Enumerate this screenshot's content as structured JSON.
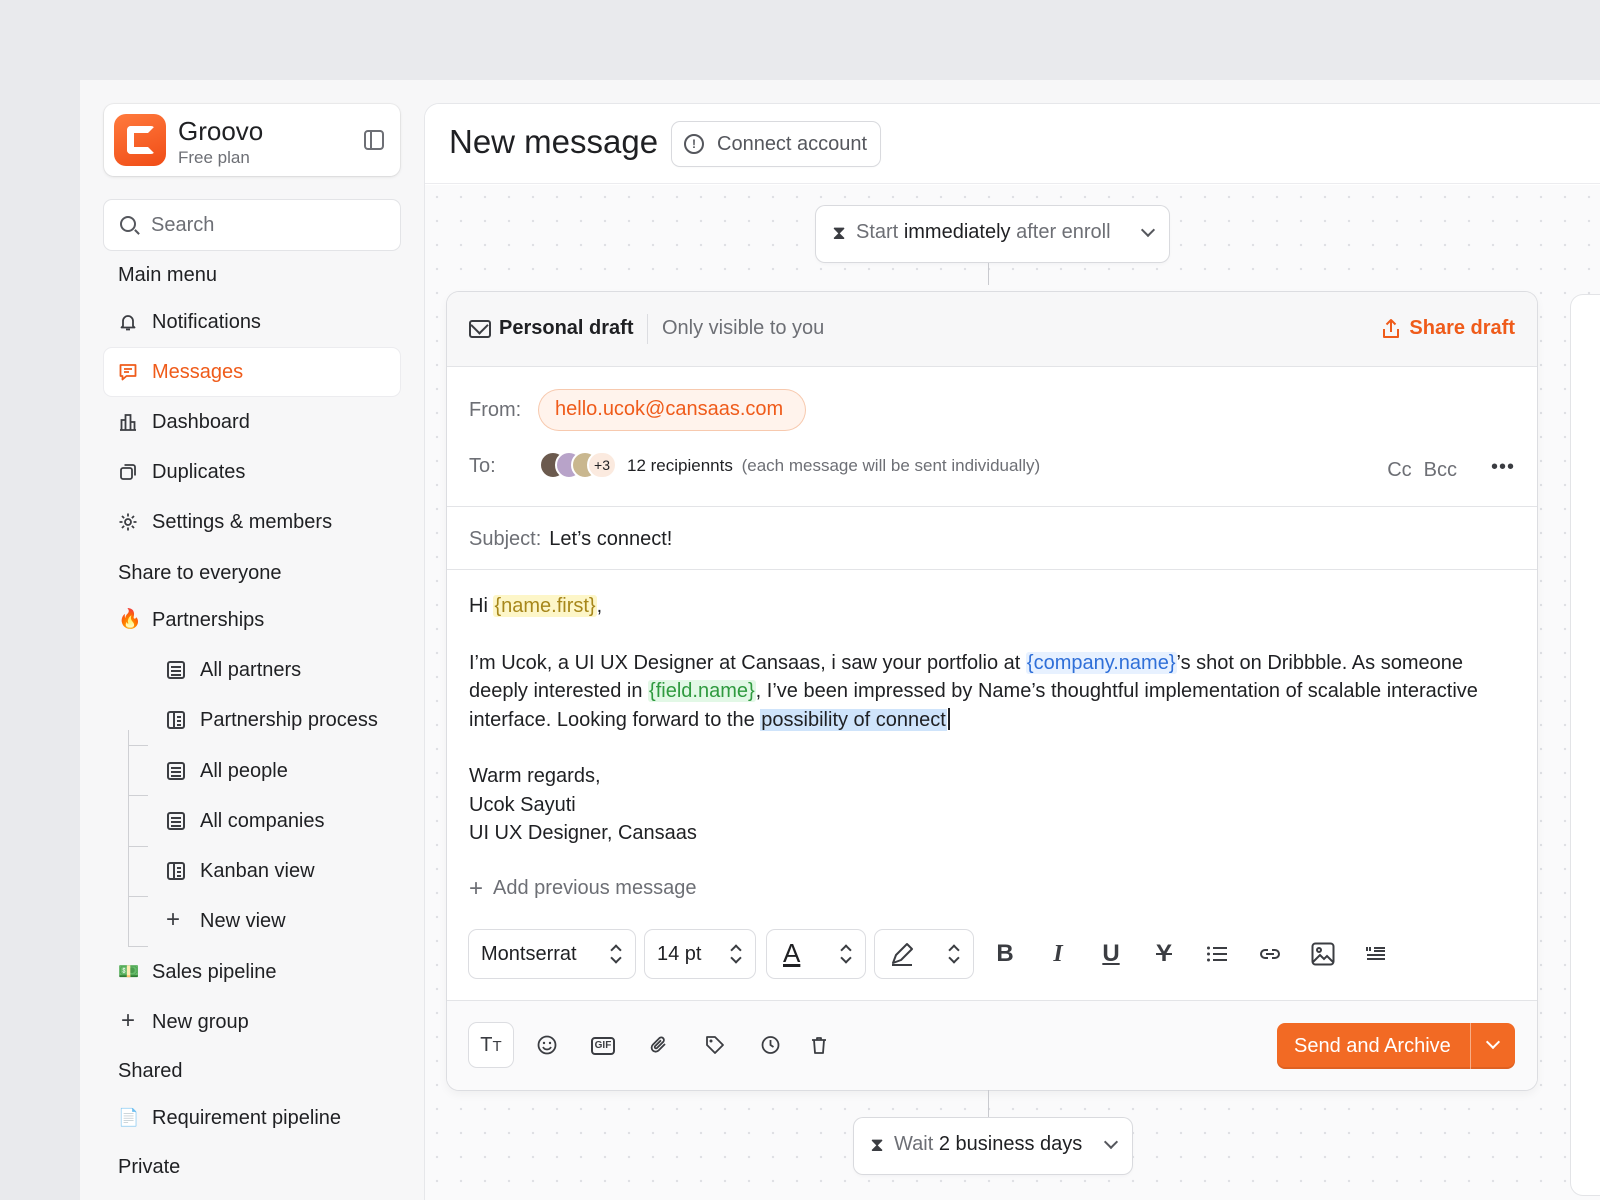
{
  "brand": {
    "name": "Groovo",
    "plan": "Free plan"
  },
  "search": {
    "placeholder": "Search"
  },
  "sidebar": {
    "main_menu_title": "Main menu",
    "main_items": [
      {
        "label": "Notifications",
        "icon": "bell-icon"
      },
      {
        "label": "Messages",
        "icon": "message-icon",
        "active": true
      },
      {
        "label": "Dashboard",
        "icon": "chart-icon"
      },
      {
        "label": "Duplicates",
        "icon": "copy-icon"
      },
      {
        "label": "Settings & members",
        "icon": "gear-icon"
      }
    ],
    "share_title": "Share to everyone",
    "partnerships": {
      "label": "Partnerships",
      "icon": "fire-icon"
    },
    "partnership_views": [
      {
        "label": "All partners",
        "icon": "table-icon"
      },
      {
        "label": "Partnership process",
        "icon": "board-icon"
      },
      {
        "label": "All people",
        "icon": "table-icon"
      },
      {
        "label": "All companies",
        "icon": "table-icon"
      },
      {
        "label": "Kanban view",
        "icon": "board-icon"
      }
    ],
    "new_view": "New view",
    "sales_pipeline": "Sales pipeline",
    "new_group": "New group",
    "shared_title": "Shared",
    "requirement_pipeline": "Requirement pipeline",
    "private_title": "Private"
  },
  "header": {
    "title": "New message",
    "connect_label": "Connect account"
  },
  "trigger": {
    "pre": "Start",
    "bold": "immediately",
    "post": "after enroll"
  },
  "wait": {
    "pre": "Wait",
    "bold": "2 business days"
  },
  "draft": {
    "title": "Personal draft",
    "visibility": "Only visible to you",
    "share_label": "Share draft",
    "from_label": "From:",
    "from_value": "hello.ucok@cansaas.com",
    "to_label": "To:",
    "recipients_more": "+3",
    "recipients_count": "12 recipiennts",
    "recipients_note": "(each message will be sent individually)",
    "cc": "Cc",
    "bcc": "Bcc",
    "subject_label": "Subject:",
    "subject_value": "Let’s connect!",
    "body": {
      "greeting": "Hi",
      "var_first": "{name.first}",
      "greeting_end": ",",
      "p1_a": "I’m Ucok, a UI UX Designer at Cansaas, i saw your portfolio at",
      "var_company": "{company.name}",
      "p1_b": "’s shot on Dribbble. As someone deeply interested in",
      "var_field": "{field.name}",
      "p1_c": ", I’ve been impressed by Name’s thoughtful implementation of scalable interactive interface. Looking forward to the",
      "p1_selected": "possibility of connect",
      "sign_1": "Warm regards,",
      "sign_2": "Ucok Sayuti",
      "sign_3": "UI UX Designer, Cansaas"
    },
    "add_previous": "Add previous message",
    "toolbar": {
      "font": "Montserrat",
      "size": "14 pt"
    },
    "send_label": "Send and Archive"
  },
  "colors": {
    "accent": "#ef5b1a",
    "send": "#f26a24"
  }
}
